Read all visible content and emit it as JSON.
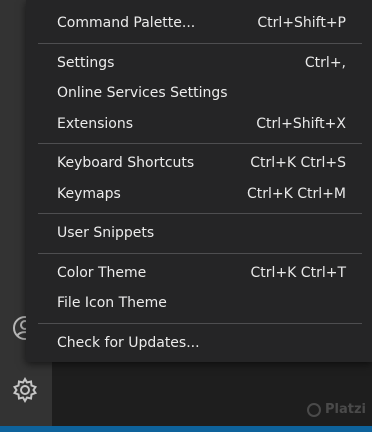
{
  "menu": {
    "groups": [
      {
        "items": [
          {
            "label": "Command Palette...",
            "shortcut": "Ctrl+Shift+P"
          }
        ]
      },
      {
        "items": [
          {
            "label": "Settings",
            "shortcut": "Ctrl+,"
          },
          {
            "label": "Online Services Settings",
            "shortcut": ""
          },
          {
            "label": "Extensions",
            "shortcut": "Ctrl+Shift+X"
          }
        ]
      },
      {
        "items": [
          {
            "label": "Keyboard Shortcuts",
            "shortcut": "Ctrl+K Ctrl+S"
          },
          {
            "label": "Keymaps",
            "shortcut": "Ctrl+K Ctrl+M"
          }
        ]
      },
      {
        "items": [
          {
            "label": "User Snippets",
            "shortcut": ""
          }
        ]
      },
      {
        "items": [
          {
            "label": "Color Theme",
            "shortcut": "Ctrl+K Ctrl+T"
          },
          {
            "label": "File Icon Theme",
            "shortcut": ""
          }
        ]
      },
      {
        "items": [
          {
            "label": "Check for Updates...",
            "shortcut": ""
          }
        ]
      }
    ]
  },
  "activity_bar": {
    "icons": [
      "account-icon",
      "gear-icon"
    ]
  },
  "watermark": {
    "text": "Platzi"
  },
  "colors": {
    "menu_bg": "#252526",
    "activity_bar_bg": "#333333",
    "editor_bg": "#1e1e1e",
    "status_bar_bg": "#0e639c"
  }
}
